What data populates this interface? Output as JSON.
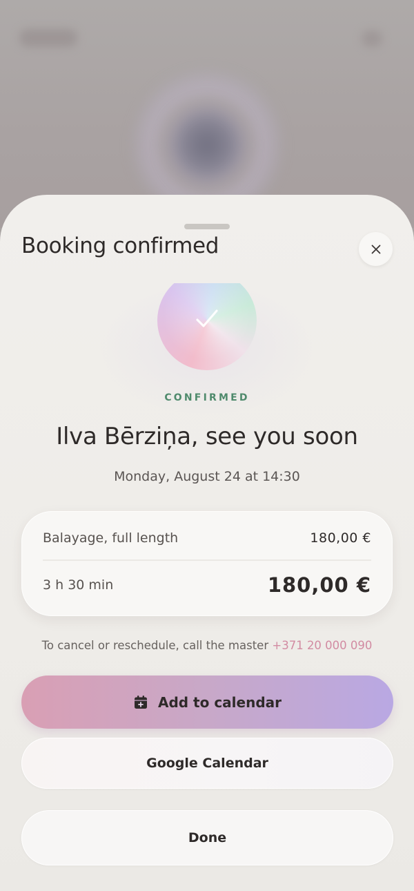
{
  "sheet": {
    "title": "Booking confirmed",
    "close_icon": "close-icon"
  },
  "confirmation": {
    "status_label": "CONFIRMED",
    "greeting": "Ilva Bērziņa, see you soon",
    "datetime": "Monday, August 24 at 14:30",
    "orb_icon": "check-icon"
  },
  "summary": {
    "service_name": "Balayage, full length",
    "service_price": "180,00 €",
    "duration": "3 h 30 min",
    "total_price": "180,00 €"
  },
  "cancel": {
    "note": "To cancel or reschedule, call the master ",
    "phone": "+371 20 000 090"
  },
  "actions": {
    "add_to_calendar_label": "Add to calendar",
    "add_to_calendar_icon": "calendar-add-icon",
    "google_calendar_label": "Google Calendar",
    "done_label": "Done"
  },
  "colors": {
    "status_green": "#4f8a6c",
    "phone_pink": "#d28ba2",
    "primary_gradient_start": "#d99fb4",
    "primary_gradient_end": "#b9a8e3",
    "sheet_background": "#f1efec",
    "text_dark": "#2e2a29"
  }
}
